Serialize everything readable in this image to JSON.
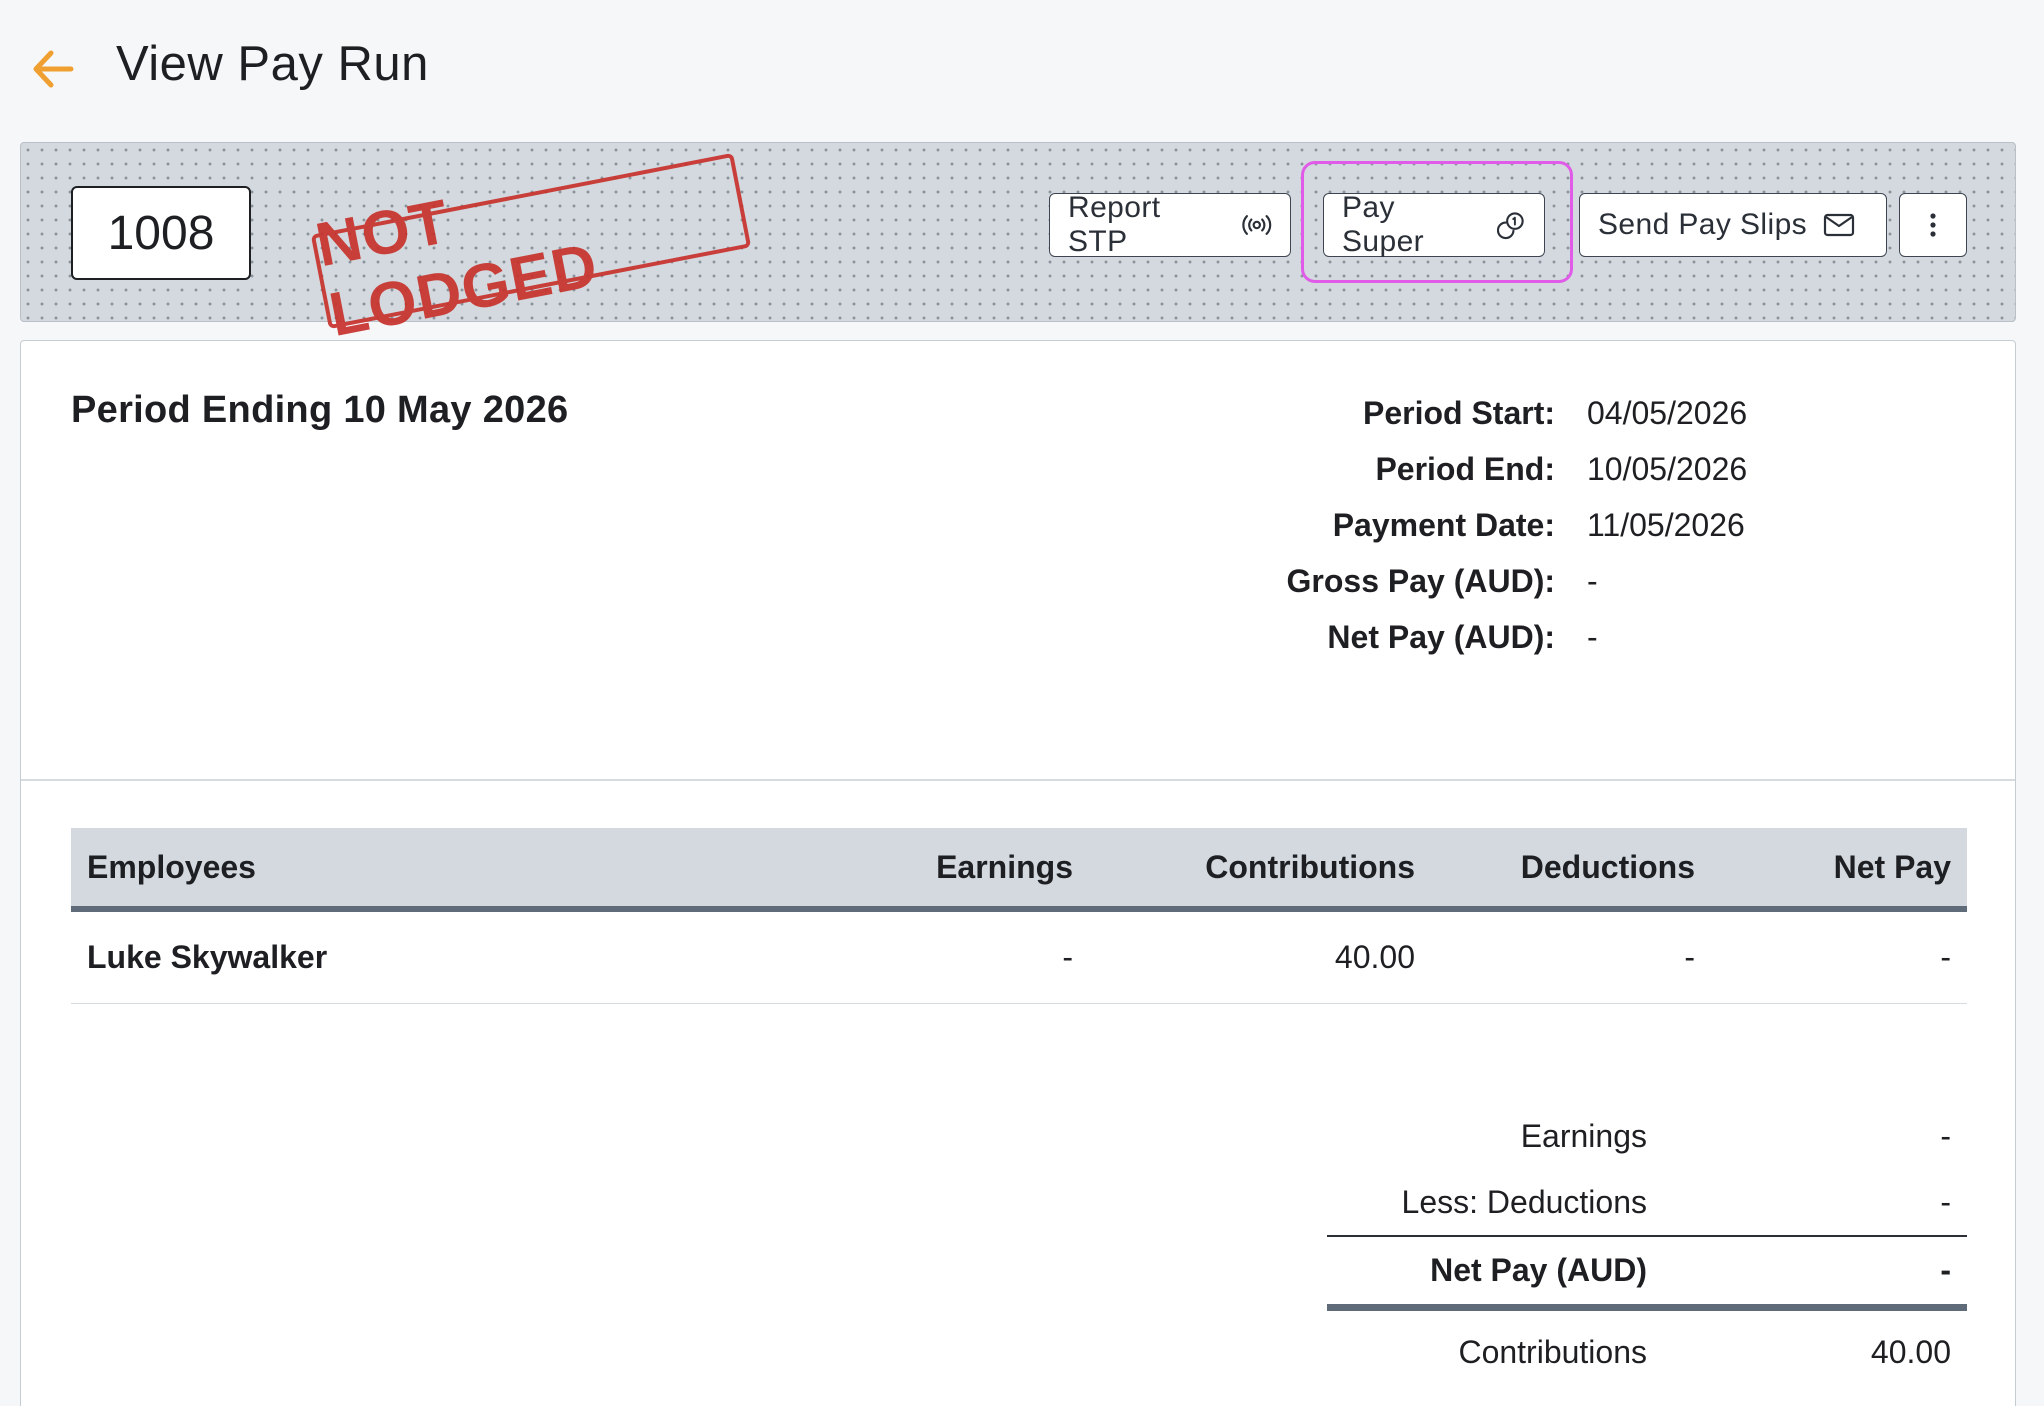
{
  "header": {
    "title": "View Pay Run",
    "back_icon": "arrow-left-icon",
    "back_color": "#f0a030"
  },
  "toolbar": {
    "payrun_number": "1008",
    "status_stamp": "NOT LODGED",
    "stamp_color": "#c8312c",
    "buttons": {
      "report_stp": "Report STP",
      "pay_super": "Pay Super",
      "send_pay_slips": "Send Pay Slips"
    },
    "focus_color": "#e05ce8"
  },
  "period": {
    "heading": "Period Ending 10 May 2026",
    "summary": [
      {
        "label": "Period Start:",
        "value": "04/05/2026"
      },
      {
        "label": "Period End:",
        "value": "10/05/2026"
      },
      {
        "label": "Payment Date:",
        "value": "11/05/2026"
      },
      {
        "label": "Gross Pay (AUD):",
        "value": "-"
      },
      {
        "label": "Net Pay (AUD):",
        "value": "-"
      }
    ]
  },
  "table": {
    "columns": [
      "Employees",
      "Earnings",
      "Contributions",
      "Deductions",
      "Net Pay"
    ],
    "rows": [
      {
        "employee": "Luke Skywalker",
        "earnings": "-",
        "contributions": "40.00",
        "deductions": "-",
        "net_pay": "-"
      }
    ]
  },
  "totals": {
    "earnings": {
      "label": "Earnings",
      "value": "-"
    },
    "deductions": {
      "label": "Less: Deductions",
      "value": "-"
    },
    "net_pay": {
      "label": "Net Pay (AUD)",
      "value": "-"
    },
    "contributions": {
      "label": "Contributions",
      "value": "40.00"
    }
  }
}
